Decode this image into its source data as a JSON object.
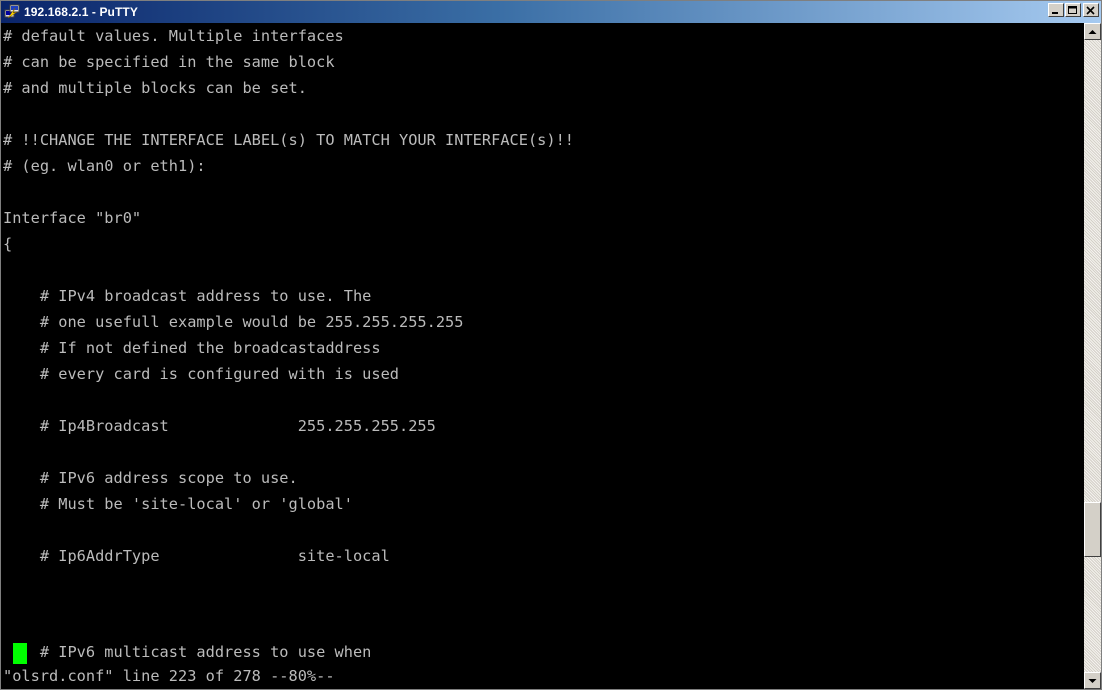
{
  "window": {
    "title": "192.168.2.1 - PuTTY",
    "app_icon": "putty-icon",
    "buttons": [
      {
        "name": "minimize-button",
        "icon": "minimize-icon"
      },
      {
        "name": "maximize-button",
        "icon": "maximize-icon"
      },
      {
        "name": "close-button",
        "icon": "close-icon"
      }
    ]
  },
  "terminal": {
    "foreground": "#bbbbbb",
    "background": "#000000",
    "cursor_color": "#00ff00",
    "lines": [
      "# default values. Multiple interfaces",
      "# can be specified in the same block",
      "# and multiple blocks can be set.",
      "",
      "# !!CHANGE THE INTERFACE LABEL(s) TO MATCH YOUR INTERFACE(s)!!",
      "# (eg. wlan0 or eth1):",
      "",
      "Interface \"br0\"",
      "{",
      "",
      "    # IPv4 broadcast address to use. The",
      "    # one usefull example would be 255.255.255.255",
      "    # If not defined the broadcastaddress",
      "    # every card is configured with is used",
      "",
      "    # Ip4Broadcast              255.255.255.255",
      "",
      "    # IPv6 address scope to use.",
      "    # Must be 'site-local' or 'global'",
      "",
      "    # Ip6AddrType               site-local",
      "",
      "    # IPv6 multicast address to use when",
      "\"olsrd.conf\" line 223 of 278 --80%--"
    ]
  },
  "scrollbar": {
    "position_fraction": 0.8,
    "up_icon": "arrow-up-icon",
    "down_icon": "arrow-down-icon"
  }
}
